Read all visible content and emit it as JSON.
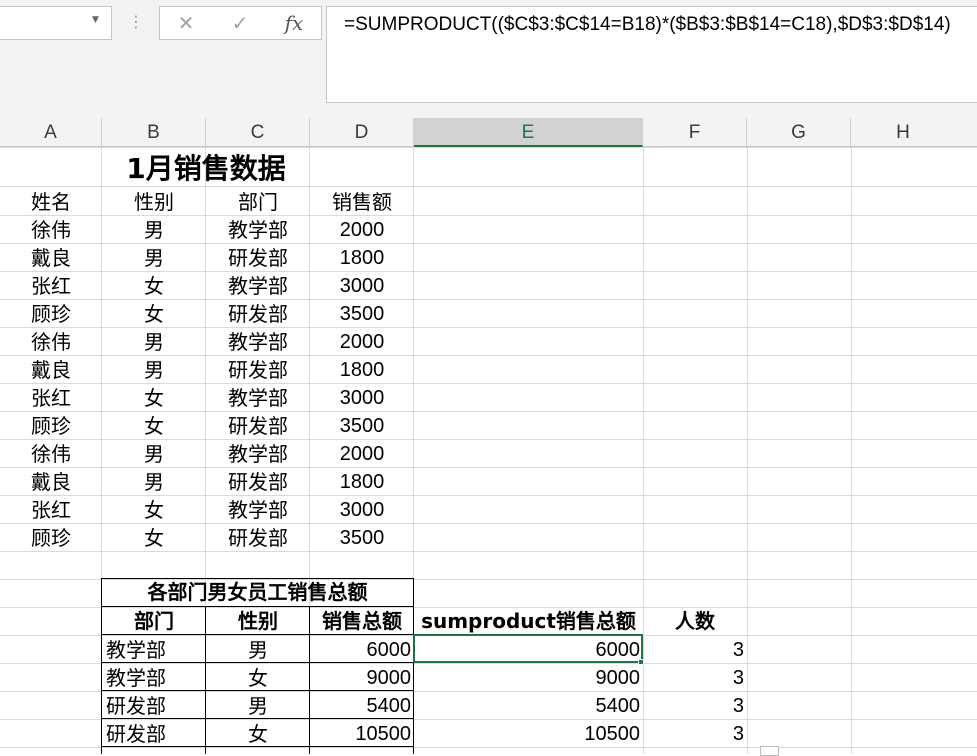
{
  "formula_bar": {
    "name_box": "",
    "cancel_icon": "✕",
    "enter_icon": "✓",
    "fx_label": "fx",
    "formula": "=SUMPRODUCT(($C$3:$C$14=B18)*($B$3:$B$14=C18),$D$3:$D$14)"
  },
  "columns": [
    "A",
    "B",
    "C",
    "D",
    "E",
    "F",
    "G",
    "H"
  ],
  "selected_column": "E",
  "sheet": {
    "title": "1月销售数据",
    "headers": [
      "姓名",
      "性别",
      "部门",
      "销售额"
    ],
    "rows": [
      [
        "徐伟",
        "男",
        "教学部",
        "2000"
      ],
      [
        "戴良",
        "男",
        "研发部",
        "1800"
      ],
      [
        "张红",
        "女",
        "教学部",
        "3000"
      ],
      [
        "顾珍",
        "女",
        "研发部",
        "3500"
      ],
      [
        "徐伟",
        "男",
        "教学部",
        "2000"
      ],
      [
        "戴良",
        "男",
        "研发部",
        "1800"
      ],
      [
        "张红",
        "女",
        "教学部",
        "3000"
      ],
      [
        "顾珍",
        "女",
        "研发部",
        "3500"
      ],
      [
        "徐伟",
        "男",
        "教学部",
        "2000"
      ],
      [
        "戴良",
        "男",
        "研发部",
        "1800"
      ],
      [
        "张红",
        "女",
        "教学部",
        "3000"
      ],
      [
        "顾珍",
        "女",
        "研发部",
        "3500"
      ]
    ]
  },
  "summary": {
    "title": "各部门男女员工销售总额",
    "headers": [
      "部门",
      "性别",
      "销售总额",
      "sumproduct销售总额",
      "人数"
    ],
    "rows": [
      [
        "教学部",
        "男",
        "6000",
        "6000",
        "3"
      ],
      [
        "教学部",
        "女",
        "9000",
        "9000",
        "3"
      ],
      [
        "研发部",
        "男",
        "5400",
        "5400",
        "3"
      ],
      [
        "研发部",
        "女",
        "10500",
        "10500",
        "3"
      ]
    ]
  },
  "colors": {
    "accent": "#217346",
    "header_bg": "#f3f3f3",
    "grid": "#dadada"
  }
}
